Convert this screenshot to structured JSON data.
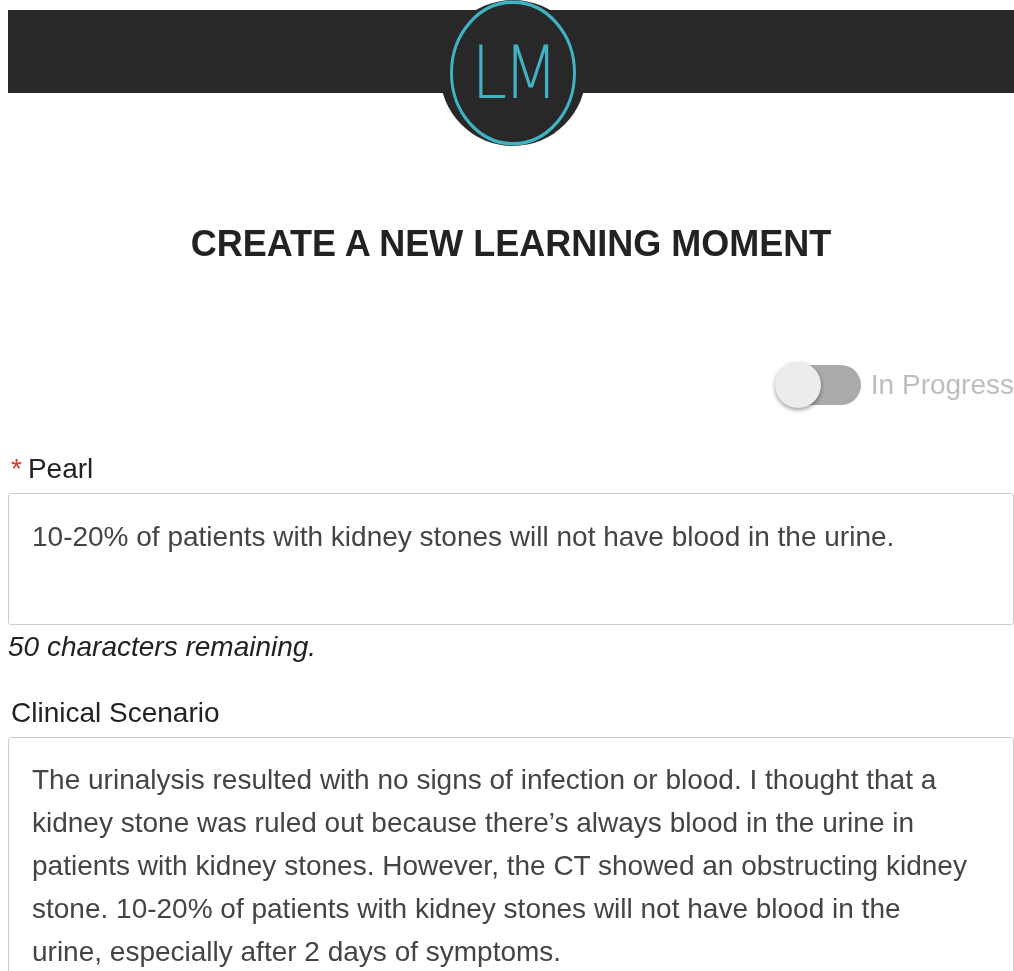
{
  "logo": {
    "text": "LM"
  },
  "title": "CREATE A NEW LEARNING MOMENT",
  "status_toggle": {
    "label": "In Progress",
    "on": false
  },
  "fields": [
    {
      "label": "Pearl",
      "required_mark": "*",
      "value": "10-20% of patients with kidney stones will not have blood in the urine.",
      "helper": "50 characters remaining."
    },
    {
      "label": "Clinical Scenario",
      "value": "The urinalysis resulted with no signs of infection or blood. I thought that a kidney stone was ruled out because there’s always blood in the urine in patients with kidney stones. However, the CT showed an obstructing kidney stone. 10-20% of patients with kidney stones will not have blood in the urine, especially after 2 days of symptoms."
    }
  ]
}
